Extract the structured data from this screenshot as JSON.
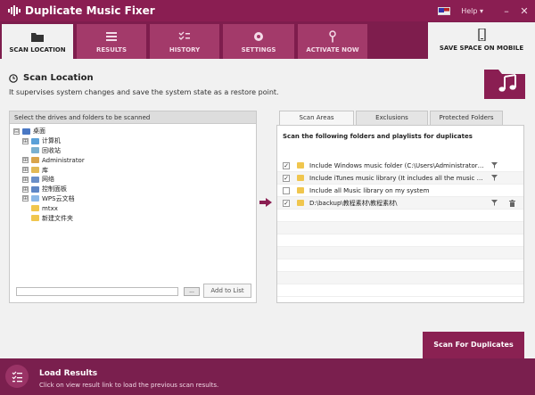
{
  "app": {
    "title": "Duplicate Music Fixer",
    "help": "Help",
    "minimize": "–",
    "close": "✕"
  },
  "tabs": [
    {
      "label": "SCAN LOCATION"
    },
    {
      "label": "RESULTS"
    },
    {
      "label": "HISTORY"
    },
    {
      "label": "SETTINGS"
    },
    {
      "label": "ACTIVATE NOW"
    },
    {
      "label": "SAVE SPACE ON MOBILE"
    }
  ],
  "section": {
    "title": "Scan Location",
    "description": "It supervises system changes and save the system state as a restore point."
  },
  "left_panel": {
    "header": "Select the drives and folders to be scanned",
    "tree": [
      {
        "label": "桌面",
        "expander": "⊟"
      },
      {
        "label": "计算机",
        "expander": "⊞"
      },
      {
        "label": "回收站",
        "expander": ""
      },
      {
        "label": "Administrator",
        "expander": "⊞"
      },
      {
        "label": "库",
        "expander": "⊞"
      },
      {
        "label": "网络",
        "expander": "⊞"
      },
      {
        "label": "控制面板",
        "expander": "⊞"
      },
      {
        "label": "WPS云文档",
        "expander": "⊞"
      },
      {
        "label": "mtxx",
        "expander": ""
      },
      {
        "label": "新建文件夹",
        "expander": ""
      }
    ],
    "path_value": "",
    "browse_label": "...",
    "add_label": "Add to List"
  },
  "right_panel": {
    "tabs": [
      "Scan Areas",
      "Exclusions",
      "Protected Folders"
    ],
    "title": "Scan the following folders and playlists for duplicates",
    "rows": [
      {
        "text": "Include Windows music folder (C:\\Users\\Administrator\\Mu...",
        "checked": "✓"
      },
      {
        "text": "Include iTunes music library (It includes all the music files p...",
        "checked": "✓"
      },
      {
        "text": "Include all Music library on my system",
        "checked": ""
      },
      {
        "text": "D:\\backup\\教程素材\\教程素材\\",
        "checked": "✓"
      }
    ]
  },
  "scan_button": "Scan For Duplicates",
  "bottom": {
    "title": "Load Results",
    "description": "Click on view result link to load the previous scan results."
  },
  "colors": {
    "brand": "#8a1e52",
    "brand_dark": "#7a1f4e",
    "tab_inactive": "#a33a6a"
  }
}
